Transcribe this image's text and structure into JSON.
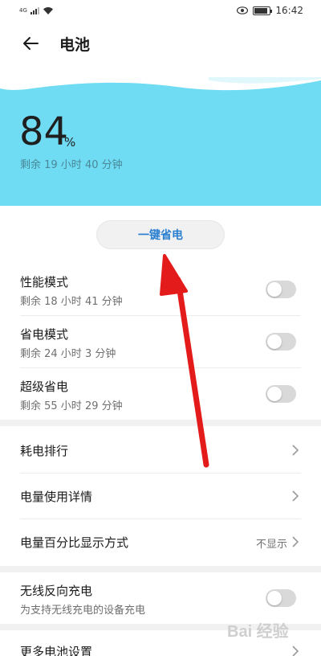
{
  "status_bar": {
    "signal_label": "4G",
    "time": "16:42"
  },
  "app_bar": {
    "title": "电池"
  },
  "hero": {
    "percent": "84",
    "percent_sign": "%",
    "remaining": "剩余 19 小时 40 分钟"
  },
  "save_button": {
    "label": "一键省电"
  },
  "modes": [
    {
      "title": "性能模式",
      "subtitle": "剩余 18 小时 41 分钟"
    },
    {
      "title": "省电模式",
      "subtitle": "剩余 24 小时 3 分钟"
    },
    {
      "title": "超级省电",
      "subtitle": "剩余 55 小时 29 分钟"
    }
  ],
  "links": [
    {
      "title": "耗电排行"
    },
    {
      "title": "电量使用详情"
    },
    {
      "title": "电量百分比显示方式",
      "value": "不显示"
    }
  ],
  "wireless": {
    "title": "无线反向充电",
    "subtitle": "为支持无线充电的设备充电"
  },
  "more": {
    "title": "更多电池设置"
  },
  "watermark": {
    "text": "Bai 经验"
  },
  "colors": {
    "hero": "#6fdcf4",
    "accent": "#2b7fd0",
    "arrow": "#e41b1b"
  }
}
